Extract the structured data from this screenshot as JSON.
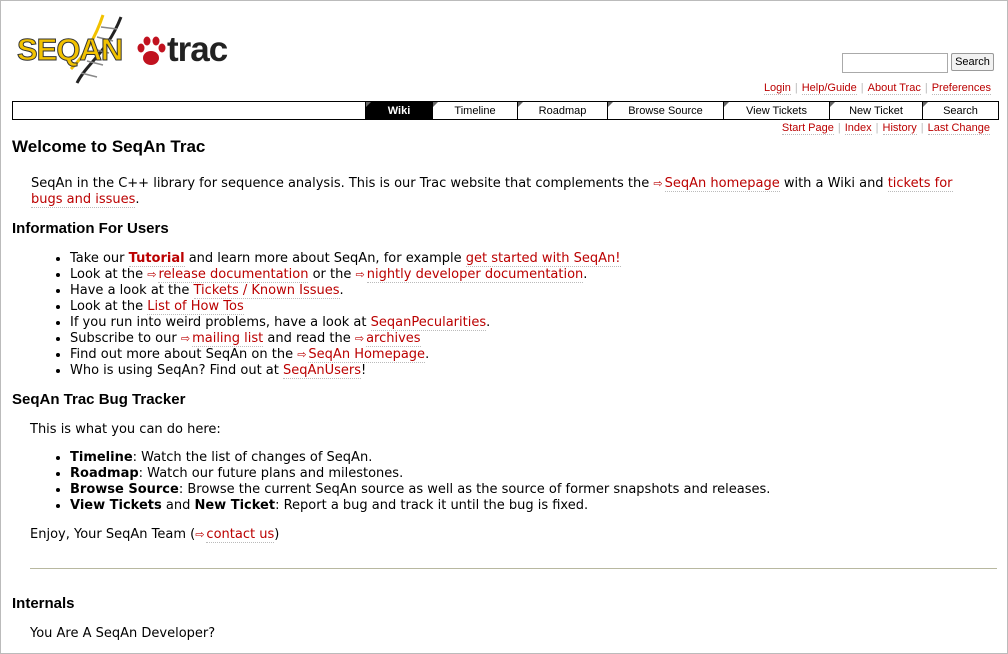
{
  "logo": {
    "word": "SEQAN",
    "trac": "trac"
  },
  "search": {
    "placeholder": "",
    "button_label": "Search"
  },
  "metanav": [
    "Login",
    "Help/Guide",
    "About Trac",
    "Preferences"
  ],
  "mainnav": {
    "tabs": [
      "Wiki",
      "Timeline",
      "Roadmap",
      "Browse Source",
      "View Tickets",
      "New Ticket",
      "Search"
    ],
    "active": "Wiki"
  },
  "ctxtnav": [
    "Start Page",
    "Index",
    "History",
    "Last Change"
  ],
  "content": {
    "title": "Welcome to SeqAn Trac",
    "intro": {
      "t1": "SeqAn in the C++ library for sequence analysis. This is our Trac website that complements the ",
      "link1": "SeqAn homepage",
      "t2": " with a Wiki and ",
      "link2a": "tickets for",
      "link2b": "bugs and issues",
      "t3": "."
    },
    "users_heading": "Information For Users",
    "users": {
      "l1": {
        "t1": "Take our ",
        "link1": "Tutorial",
        "t2": " and learn more about SeqAn, for example ",
        "link2": "get started with SeqAn!"
      },
      "l2": {
        "t1": "Look at the ",
        "link1": "release documentation",
        "t2": " or the ",
        "link2": "nightly developer documentation",
        "t3": "."
      },
      "l3": {
        "t1": "Have a look at the ",
        "link1": "Tickets / Known Issues",
        "t2": "."
      },
      "l4": {
        "t1": "Look at the ",
        "link1": "List of How Tos"
      },
      "l5": {
        "t1": "If you run into weird problems, have a look at ",
        "link1": "SeqanPecularities",
        "t2": "."
      },
      "l6": {
        "t1": "Subscribe to our ",
        "link1": "mailing list",
        "t2": " and read the ",
        "link2": "archives"
      },
      "l7": {
        "t1": "Find out more about SeqAn on the ",
        "link1": "SeqAn Homepage",
        "t2": "."
      },
      "l8": {
        "t1": "Who is using SeqAn? Find out at ",
        "link1": "SeqAnUsers",
        "t2": "!"
      }
    },
    "bug_heading": "SeqAn Trac Bug Tracker",
    "bug_intro": "This is what you can do here:",
    "bug": {
      "b1": {
        "bold": "Timeline",
        "t": ": Watch the list of changes of SeqAn."
      },
      "b2": {
        "bold": "Roadmap",
        "t": ": Watch our future plans and milestones."
      },
      "b3": {
        "bold": "Browse Source",
        "t": ": Browse the current SeqAn source as well as the source of former snapshots and releases."
      },
      "b4": {
        "bold1": "View Tickets",
        "mid": " and ",
        "bold2": "New Ticket",
        "t": ": Report a bug and track it until the bug is fixed."
      }
    },
    "enjoy": {
      "t1": "Enjoy, Your SeqAn Team (",
      "link": "contact us",
      "t2": ")"
    },
    "internals_heading": "Internals",
    "internals_text": "You Are A SeqAn Developer?"
  },
  "colors": {
    "link": "#bb0000",
    "logo_yellow": "#f2c200",
    "paw_red": "#c1121f"
  },
  "icons": [
    "dna-helix-icon",
    "paw-icon",
    "external-link-icon"
  ]
}
